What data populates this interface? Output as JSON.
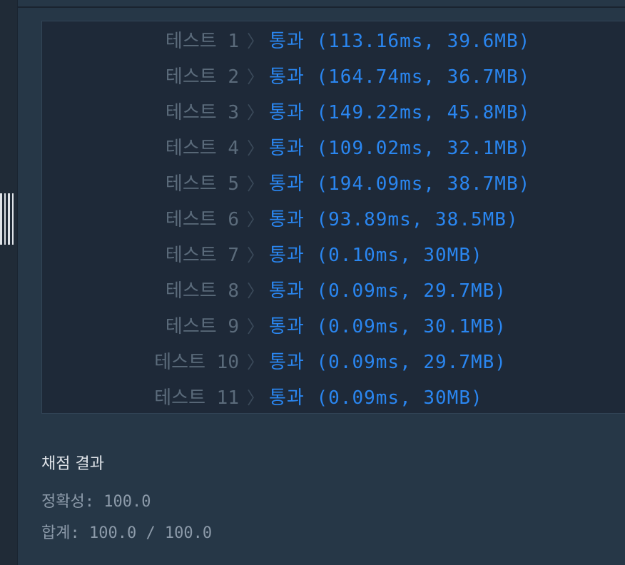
{
  "tests": [
    {
      "label": "테스트 1",
      "status": "통과 (113.16ms, 39.6MB)"
    },
    {
      "label": "테스트 2",
      "status": "통과 (164.74ms, 36.7MB)"
    },
    {
      "label": "테스트 3",
      "status": "통과 (149.22ms, 45.8MB)"
    },
    {
      "label": "테스트 4",
      "status": "통과 (109.02ms, 32.1MB)"
    },
    {
      "label": "테스트 5",
      "status": "통과 (194.09ms, 38.7MB)"
    },
    {
      "label": "테스트 6",
      "status": "통과 (93.89ms, 38.5MB)"
    },
    {
      "label": "테스트 7",
      "status": "통과 (0.10ms, 30MB)"
    },
    {
      "label": "테스트 8",
      "status": "통과 (0.09ms, 29.7MB)"
    },
    {
      "label": "테스트 9",
      "status": "통과 (0.09ms, 30.1MB)"
    },
    {
      "label": "테스트 10",
      "status": "통과 (0.09ms, 29.7MB)"
    },
    {
      "label": "테스트 11",
      "status": "통과 (0.09ms, 30MB)"
    }
  ],
  "separator": "〉",
  "summary": {
    "title": "채점 결과",
    "accuracy": "정확성: 100.0",
    "total": "합계: 100.0 / 100.0"
  }
}
